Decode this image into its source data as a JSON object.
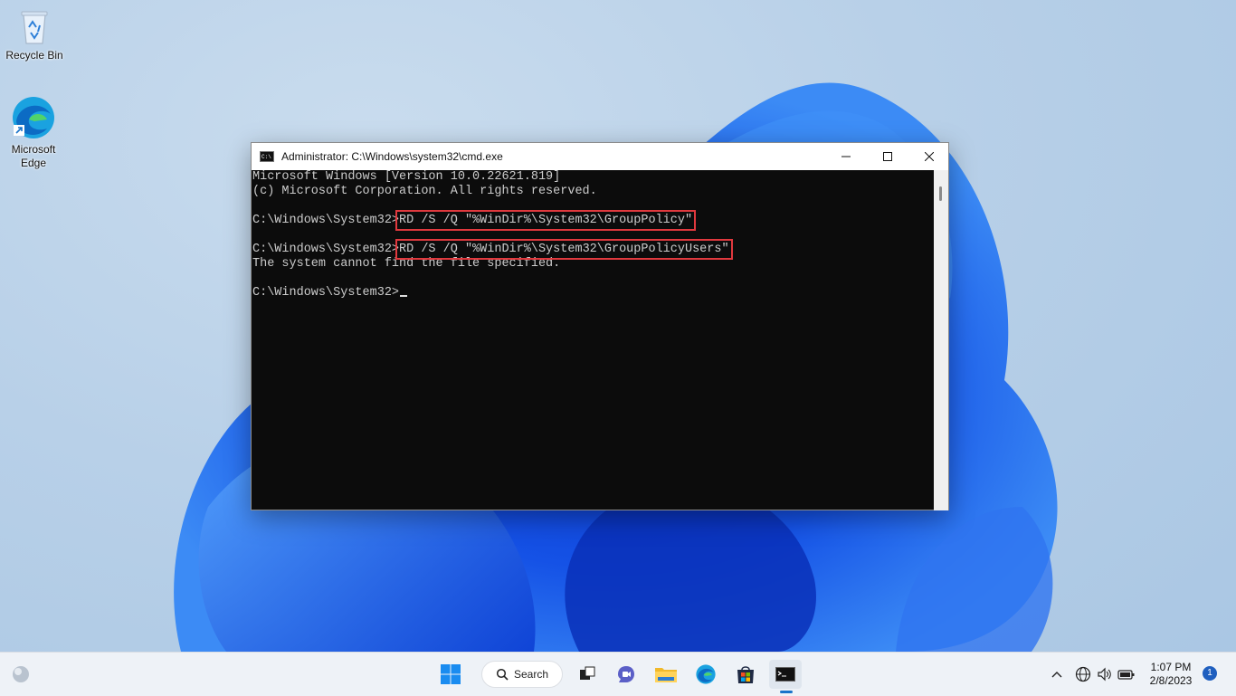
{
  "desktop": {
    "icons": [
      {
        "label": "Recycle Bin"
      },
      {
        "label": "Microsoft Edge"
      }
    ]
  },
  "window": {
    "title": "Administrator: C:\\Windows\\system32\\cmd.exe",
    "controls": {
      "minimize": "—",
      "maximize": "☐",
      "close": "✕"
    }
  },
  "console": {
    "lines": [
      "Microsoft Windows [Version 10.0.22621.819]",
      "(c) Microsoft Corporation. All rights reserved.",
      "",
      "C:\\Windows\\System32>",
      "RD /S /Q \"%WinDir%\\System32\\GroupPolicy\"",
      "",
      "C:\\Windows\\System32>",
      "RD /S /Q \"%WinDir%\\System32\\GroupPolicyUsers\"",
      "The system cannot find the file specified.",
      "",
      "C:\\Windows\\System32>"
    ]
  },
  "taskbar": {
    "search_label": "Search",
    "time": "1:07 PM",
    "date": "2/8/2023",
    "notification_count": "1"
  },
  "colors": {
    "highlight": "#e0393e",
    "accent": "#1a73c9",
    "console_bg": "#0c0c0c"
  }
}
